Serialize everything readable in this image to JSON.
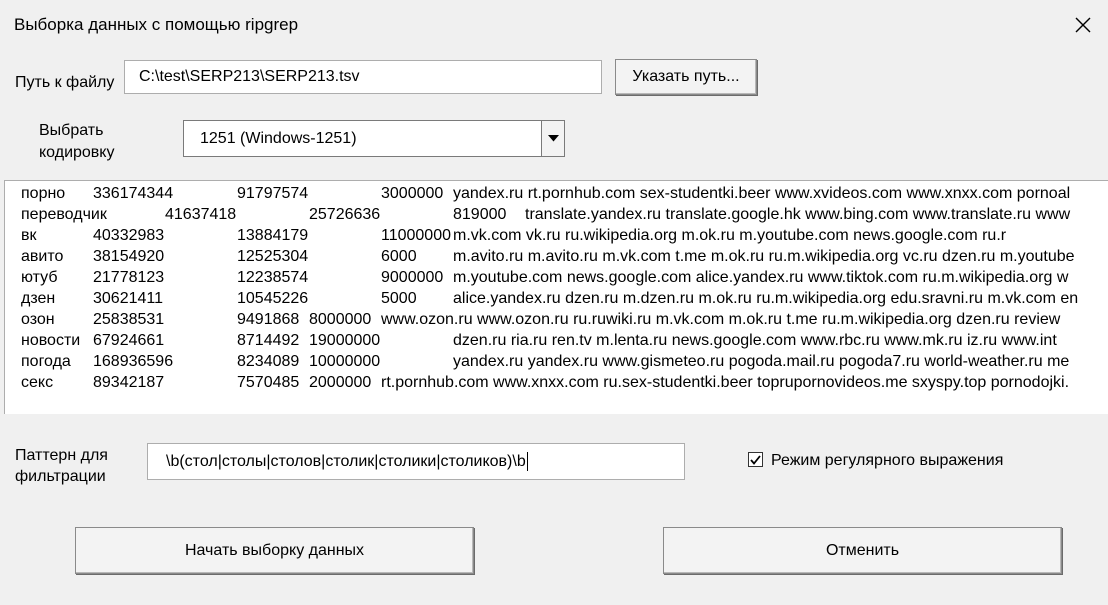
{
  "window": {
    "title": "Выборка данных с помощью ripgrep"
  },
  "file": {
    "label": "Путь к файлу",
    "path": "C:\\test\\SERP213\\SERP213.tsv",
    "browse_button": "Указать путь..."
  },
  "encoding": {
    "label_line1": "Выбрать",
    "label_line2": "кодировку",
    "selected": "1251 (Windows-1251)"
  },
  "list": {
    "rows": [
      {
        "query": "порно",
        "c1": "336174344",
        "c2": "91797574",
        "c3": "3000000",
        "sites": "yandex.ru rt.pornhub.com sex-studentki.beer www.xvideos.com www.xnxx.com pornoal"
      },
      {
        "query": "переводчик",
        "c1": "41637418",
        "c2": "25726636",
        "c3": "819000",
        "sites": "translate.yandex.ru translate.google.hk www.bing.com www.translate.ru www"
      },
      {
        "query": "вк",
        "c1": "40332983",
        "c2": "13884179",
        "c3": "11000000",
        "sites": "m.vk.com vk.ru ru.wikipedia.org m.ok.ru m.youtube.com news.google.com ru.r"
      },
      {
        "query": "авито",
        "c1": "38154920",
        "c2": "12525304",
        "c3": "6000",
        "sites": "m.avito.ru m.avito.ru m.vk.com t.me m.ok.ru ru.m.wikipedia.org vc.ru dzen.ru m.youtube"
      },
      {
        "query": "ютуб",
        "c1": "21778123",
        "c2": "12238574",
        "c3": "9000000",
        "sites": "m.youtube.com news.google.com alice.yandex.ru www.tiktok.com ru.m.wikipedia.org w"
      },
      {
        "query": "дзен",
        "c1": "30621411",
        "c2": "10545226",
        "c3": "5000",
        "sites": "alice.yandex.ru dzen.ru m.dzen.ru m.ok.ru ru.m.wikipedia.org edu.sravni.ru m.vk.com en"
      },
      {
        "query": "озон",
        "c1": "25838531",
        "c2": "9491868",
        "c3": "8000000",
        "sites": "www.ozon.ru www.ozon.ru ru.ruwiki.ru m.vk.com m.ok.ru t.me ru.m.wikipedia.org dzen.ru review"
      },
      {
        "query": "новости",
        "c1": "67924661",
        "c2": "8714492",
        "c3": "19000000",
        "sites": "dzen.ru ria.ru ren.tv m.lenta.ru news.google.com www.rbc.ru www.mk.ru iz.ru www.int"
      },
      {
        "query": "погода",
        "c1": "168936596",
        "c2": "8234089",
        "c3": "10000000",
        "sites": "yandex.ru yandex.ru www.gismeteo.ru pogoda.mail.ru pogoda7.ru world-weather.ru me"
      },
      {
        "query": "секс",
        "c1": "89342187",
        "c2": "7570485",
        "c3": "2000000",
        "sites": "rt.pornhub.com www.xnxx.com ru.sex-studentki.beer toprupornovideos.me sxyspy.top pornodojki."
      }
    ]
  },
  "pattern": {
    "label_line1": "Паттерн для",
    "label_line2": "фильтрации",
    "value": "\\b(стол|столы|столов|столик|столики|столиков)\\b"
  },
  "regex_mode": {
    "label": "Режим регулярного выражения",
    "checked": true
  },
  "actions": {
    "start_button": "Начать выборку данных",
    "cancel_button": "Отменить"
  }
}
